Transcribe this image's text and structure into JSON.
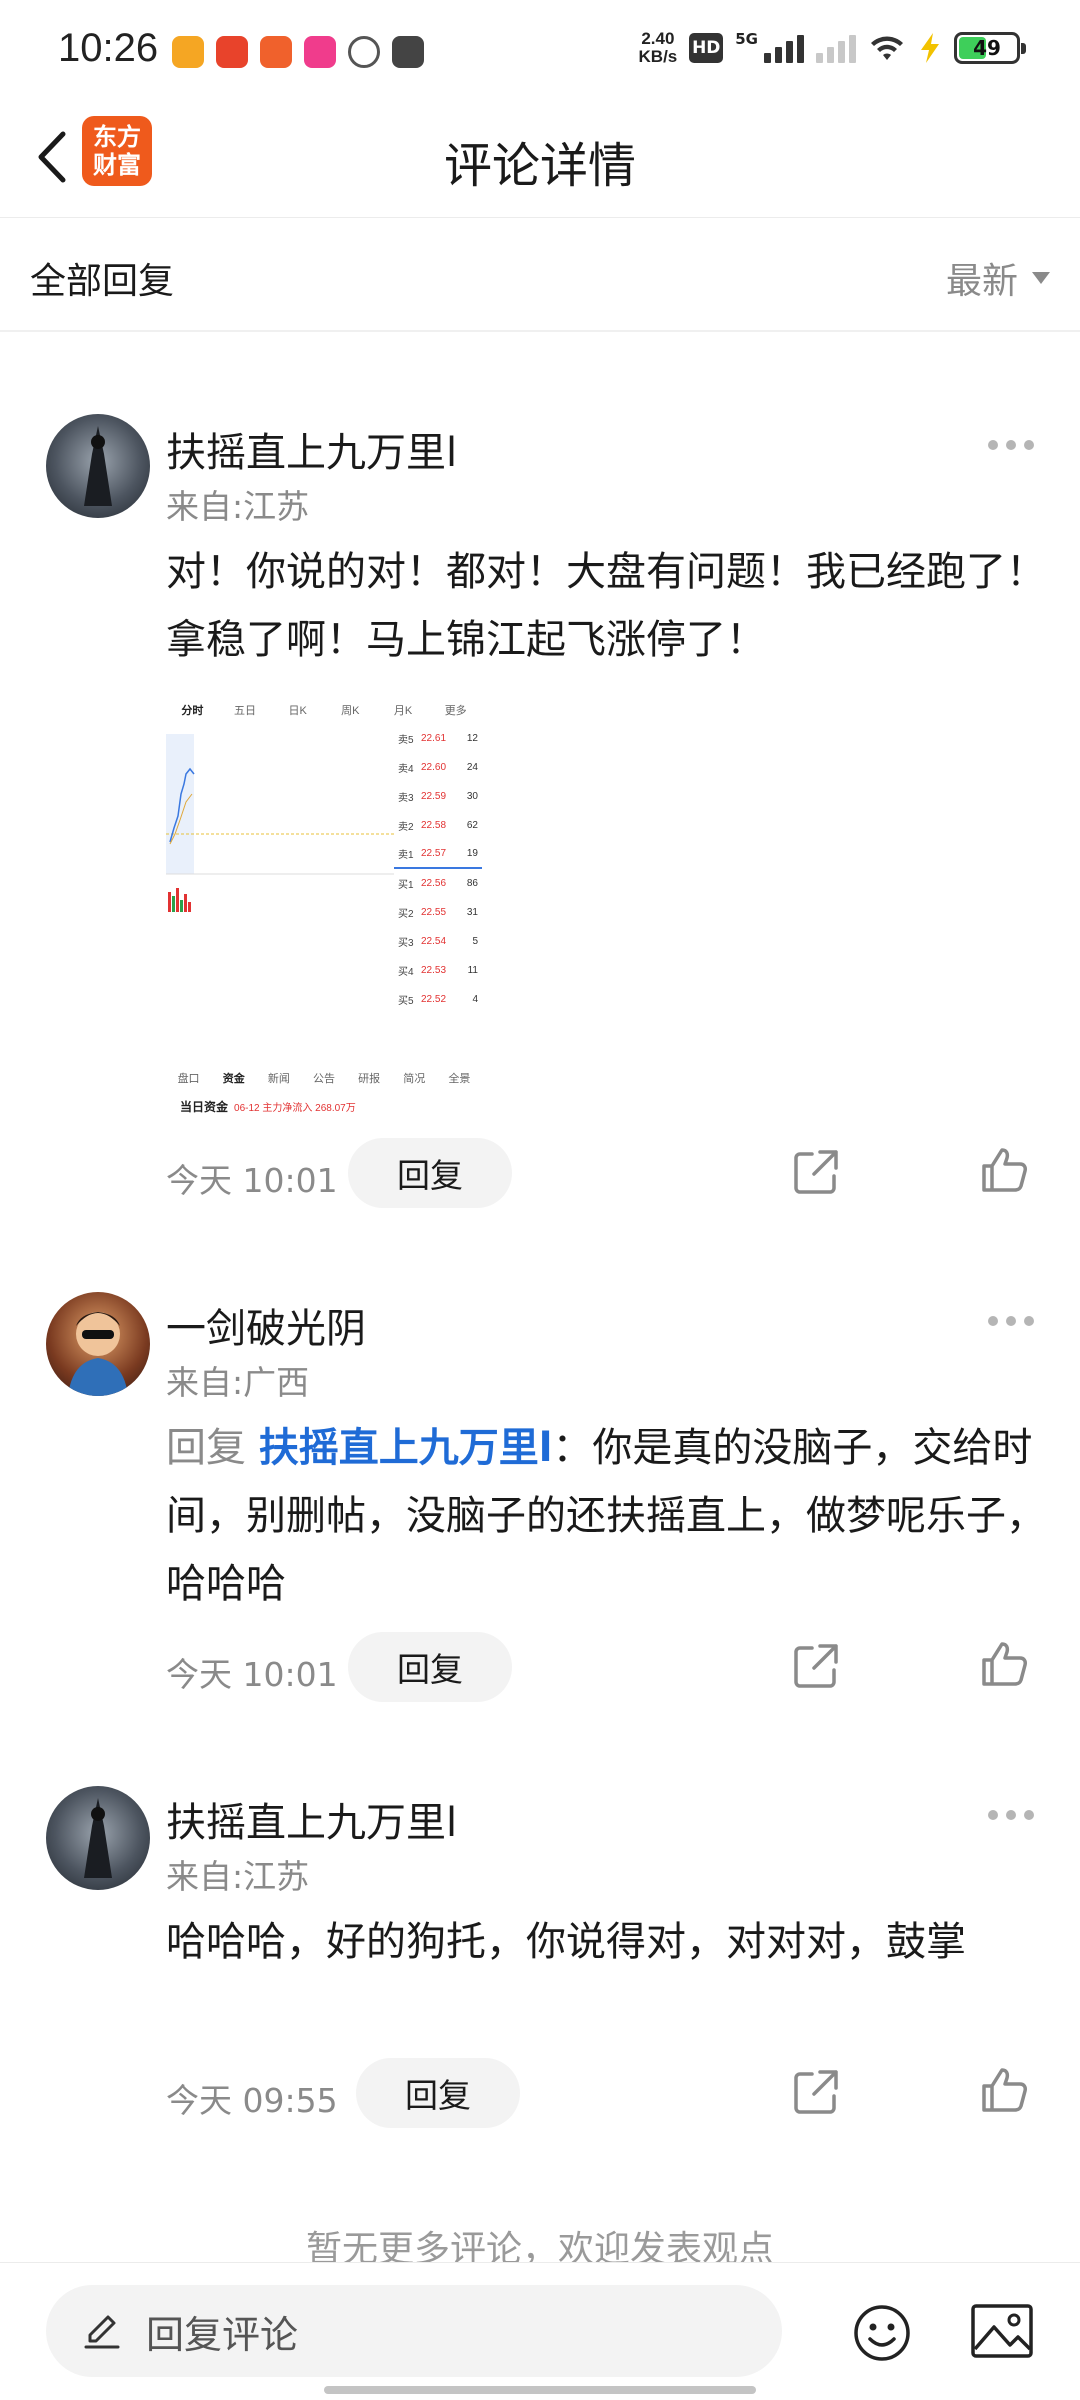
{
  "status_bar": {
    "time": "10:26",
    "speed_value": "2.40",
    "speed_unit": "KB/s",
    "hd_label": "HD",
    "network": "5G",
    "battery": "49",
    "battery_level_percent": 49,
    "app_icon_colors": [
      "#f5a623",
      "#e8432b",
      "#f0612c",
      "#f03c8c",
      "#555555",
      "#444444"
    ]
  },
  "header": {
    "title": "评论详情",
    "logo_line1": "东方",
    "logo_line2": "财富",
    "brand_color": "#ef5a1c"
  },
  "filter": {
    "label": "全部回复",
    "sort_value": "最新"
  },
  "comments": [
    {
      "username": "扶摇直上九万里l",
      "location": "来自:江苏",
      "text": "对！你说的对！都对！大盘有问题！我已经跑了！拿稳了啊！马上锦江起飞涨停了！",
      "time": "今天 10:01",
      "reply_label": "回复",
      "has_image": true
    },
    {
      "username": "一剑破光阴",
      "location": "来自:广西",
      "reply_prefix": "回复 ",
      "reply_target": "扶摇直上九万里l",
      "text": "：你是真的没脑子，交给时间，别删帖，没脑子的还扶摇直上，做梦呢乐子，哈哈哈",
      "time": "今天 10:01",
      "reply_label": "回复"
    },
    {
      "username": "扶摇直上九万里l",
      "location": "来自:江苏",
      "text": "哈哈哈，好的狗托，你说得对，对对对，鼓掌",
      "time": "今天 09:55",
      "reply_label": "回复"
    }
  ],
  "stock_image": {
    "tabs": [
      "分时",
      "五日",
      "日K",
      "周K",
      "月K",
      "更多"
    ],
    "order_book": [
      {
        "label": "卖5",
        "price": "22.61",
        "volume": "12"
      },
      {
        "label": "卖4",
        "price": "22.60",
        "volume": "24"
      },
      {
        "label": "卖3",
        "price": "22.59",
        "volume": "30"
      },
      {
        "label": "卖2",
        "price": "22.58",
        "volume": "62"
      },
      {
        "label": "卖1",
        "price": "22.57",
        "volume": "19"
      },
      {
        "label": "买1",
        "price": "22.56",
        "volume": "86"
      },
      {
        "label": "买2",
        "price": "22.55",
        "volume": "31"
      },
      {
        "label": "买3",
        "price": "22.54",
        "volume": "5"
      },
      {
        "label": "买4",
        "price": "22.53",
        "volume": "11"
      },
      {
        "label": "买5",
        "price": "22.52",
        "volume": "4"
      }
    ],
    "bottom_tabs": [
      "盘口",
      "资金",
      "新闻",
      "公告",
      "研报",
      "简况",
      "全景"
    ],
    "fund_label": "当日资金",
    "fund_value": "06-12 主力净流入 268.07万"
  },
  "footer_note": "暂无更多评论，欢迎发表观点",
  "bottom_bar": {
    "input_placeholder": "回复评论"
  }
}
